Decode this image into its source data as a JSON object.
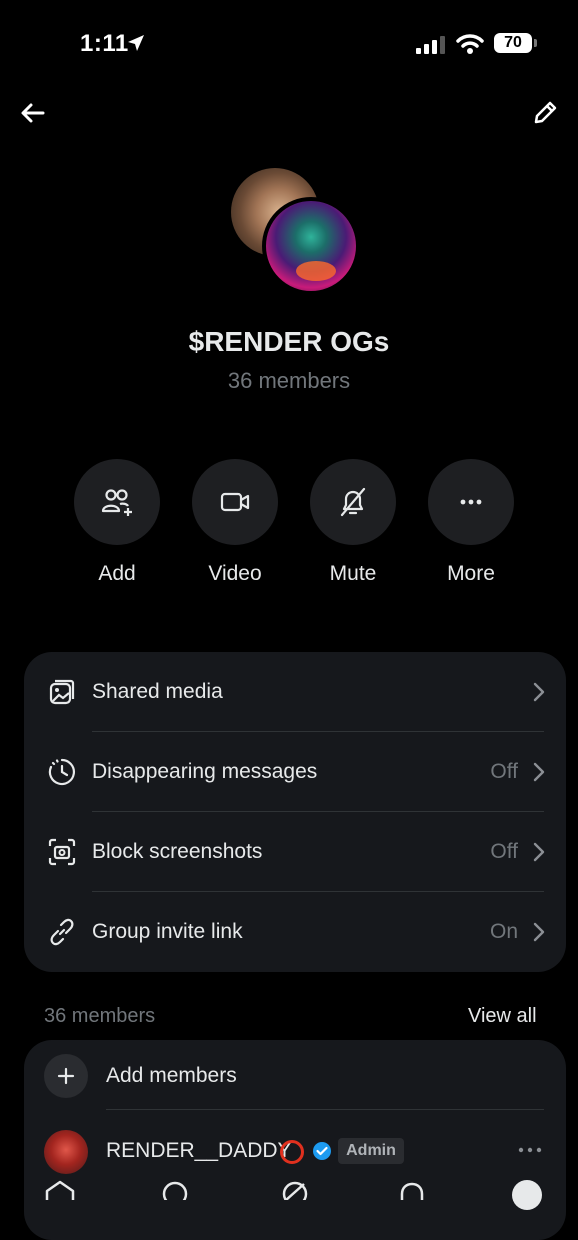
{
  "status_bar": {
    "time": "1:11",
    "battery": "70"
  },
  "group": {
    "title": "$RENDER OGs",
    "member_count": "36 members"
  },
  "actions": [
    {
      "label": "Add",
      "icon": "add-people-icon"
    },
    {
      "label": "Video",
      "icon": "video-icon"
    },
    {
      "label": "Mute",
      "icon": "mute-bell-icon"
    },
    {
      "label": "More",
      "icon": "more-horizontal-icon"
    }
  ],
  "settings": [
    {
      "label": "Shared media",
      "value": "",
      "icon": "shared-media-icon"
    },
    {
      "label": "Disappearing messages",
      "value": "Off",
      "icon": "timer-icon"
    },
    {
      "label": "Block screenshots",
      "value": "Off",
      "icon": "screenshot-camera-icon"
    },
    {
      "label": "Group invite link",
      "value": "On",
      "icon": "link-icon"
    }
  ],
  "members_section": {
    "header": "36 members",
    "view_all": "View all",
    "add_members": "Add members",
    "members": [
      {
        "name": "RENDER__DADDY",
        "badge": "Admin",
        "verified": true
      }
    ]
  },
  "colors": {
    "background": "#000000",
    "card": "#16181c",
    "muted_text": "#71767b",
    "verified_blue": "#1d9bf0"
  }
}
